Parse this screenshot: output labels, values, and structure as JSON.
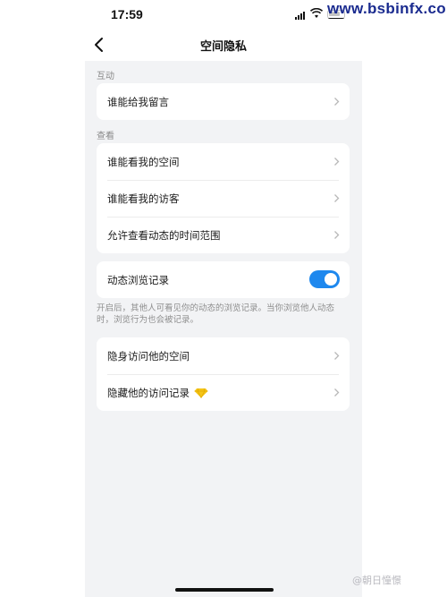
{
  "status": {
    "time": "17:59",
    "watermark": "www.bsbinfx.com"
  },
  "nav": {
    "title": "空间隐私"
  },
  "sections": {
    "interaction": {
      "label": "互动",
      "items": [
        {
          "label": "谁能给我留言"
        }
      ]
    },
    "view": {
      "label": "查看",
      "items": [
        {
          "label": "谁能看我的空间"
        },
        {
          "label": "谁能看我的访客"
        },
        {
          "label": "允许查看动态的时间范围"
        }
      ]
    },
    "browse": {
      "label": "动态浏览记录",
      "enabled": true,
      "hint": "开启后，其他人可看见你的动态的浏览记录。当你浏览他人动态时，浏览行为也会被记录。"
    },
    "stealth": {
      "items": [
        {
          "label": "隐身访问他的空间"
        },
        {
          "label": "隐藏他的访问记录",
          "badge_icon": "diamond-icon"
        }
      ]
    }
  },
  "footer": {
    "watermark": "@朝日憧憬"
  },
  "colors": {
    "toggle_on": "#1e88ee",
    "page_bg": "#f2f3f5",
    "diamond": "#f5c518"
  }
}
